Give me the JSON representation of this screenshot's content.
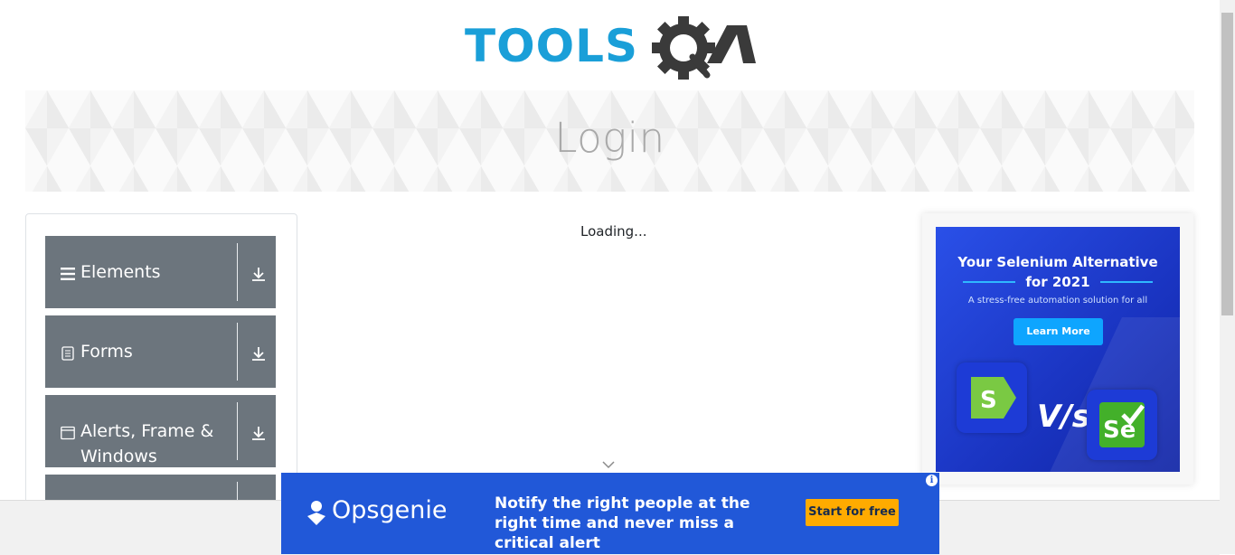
{
  "header": {
    "logo_text_left": "TOOLS",
    "logo_text_right": "QA"
  },
  "banner": {
    "title": "Login"
  },
  "sidebar": {
    "groups": [
      {
        "label": "Elements",
        "icon": "hamburger-icon",
        "action_icon": "download-arrow-icon"
      },
      {
        "label": "Forms",
        "icon": "document-icon",
        "action_icon": "download-arrow-icon"
      },
      {
        "label": "Alerts, Frame & Windows",
        "icon": "window-icon",
        "action_icon": "download-arrow-icon"
      },
      {
        "label": "",
        "icon": "",
        "action_icon": "download-arrow-icon"
      }
    ]
  },
  "main": {
    "loading_text": "Loading..."
  },
  "right_ad": {
    "headline": "Your Selenium Alternative for 2021",
    "subline": "A stress-free automation solution for all",
    "button_label": "Learn More",
    "vs_text": "V/s",
    "tile_right_label": "Se"
  },
  "bottom_ad": {
    "brand": "Opsgenie",
    "message": "Notify the right people at the right time and never miss a critical alert",
    "button_label": "Start for free",
    "info_icon": "i"
  },
  "colors": {
    "nav_group_bg": "#6c757d",
    "banner_title": "#a9a9a9",
    "opsgenie_bg": "#2158d8",
    "opsgenie_button": "#ffab00",
    "logo_blue": "#1a9fd8",
    "logo_dark": "#3a3a3a"
  }
}
